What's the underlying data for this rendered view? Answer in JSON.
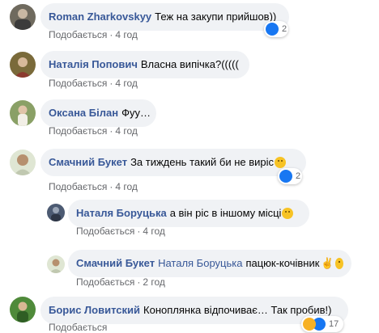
{
  "comments": [
    {
      "author": "Roman Zharkovskyy",
      "text": "Теж на закупи прийшов))",
      "like_label": "Подобається",
      "time": "4 год",
      "reaction_count": "2"
    },
    {
      "author": "Наталія Попович",
      "text": "Власна випічка?(((((",
      "like_label": "Подобається",
      "time": "4 год"
    },
    {
      "author": "Оксана Білан",
      "text": "Фуу…",
      "like_label": "Подобається",
      "time": "4 год"
    },
    {
      "author": "Смачний Букет",
      "text": "За тиждень такий би не виріс",
      "like_label": "Подобається",
      "time": "4 год",
      "reaction_count": "2"
    }
  ],
  "replies": [
    {
      "author": "Наталя Боруцька",
      "text": "а він ріс в іншому місці",
      "like_label": "Подобається",
      "time": "4 год"
    },
    {
      "author": "Смачний Букет",
      "mention": "Наталя Боруцька",
      "text": "пацюк-кочівник",
      "like_label": "Подобається",
      "time": "2 год"
    }
  ],
  "last_comment": {
    "author": "Борис Ловитский",
    "text": "Коноплянка відпочиває… Так пробив!)",
    "like_label": "Подобається",
    "reaction_count": "17"
  },
  "colors": {
    "author_link": "#385898",
    "bubble_bg": "#f0f2f5",
    "meta_text": "#65676b",
    "like_reaction": "#1877f2",
    "haha_reaction": "#f7b125"
  },
  "icons": {
    "like": "like-icon",
    "haha": "haha-icon",
    "emoji": "smile-emoji",
    "victory": "victory-hand-emoji"
  }
}
